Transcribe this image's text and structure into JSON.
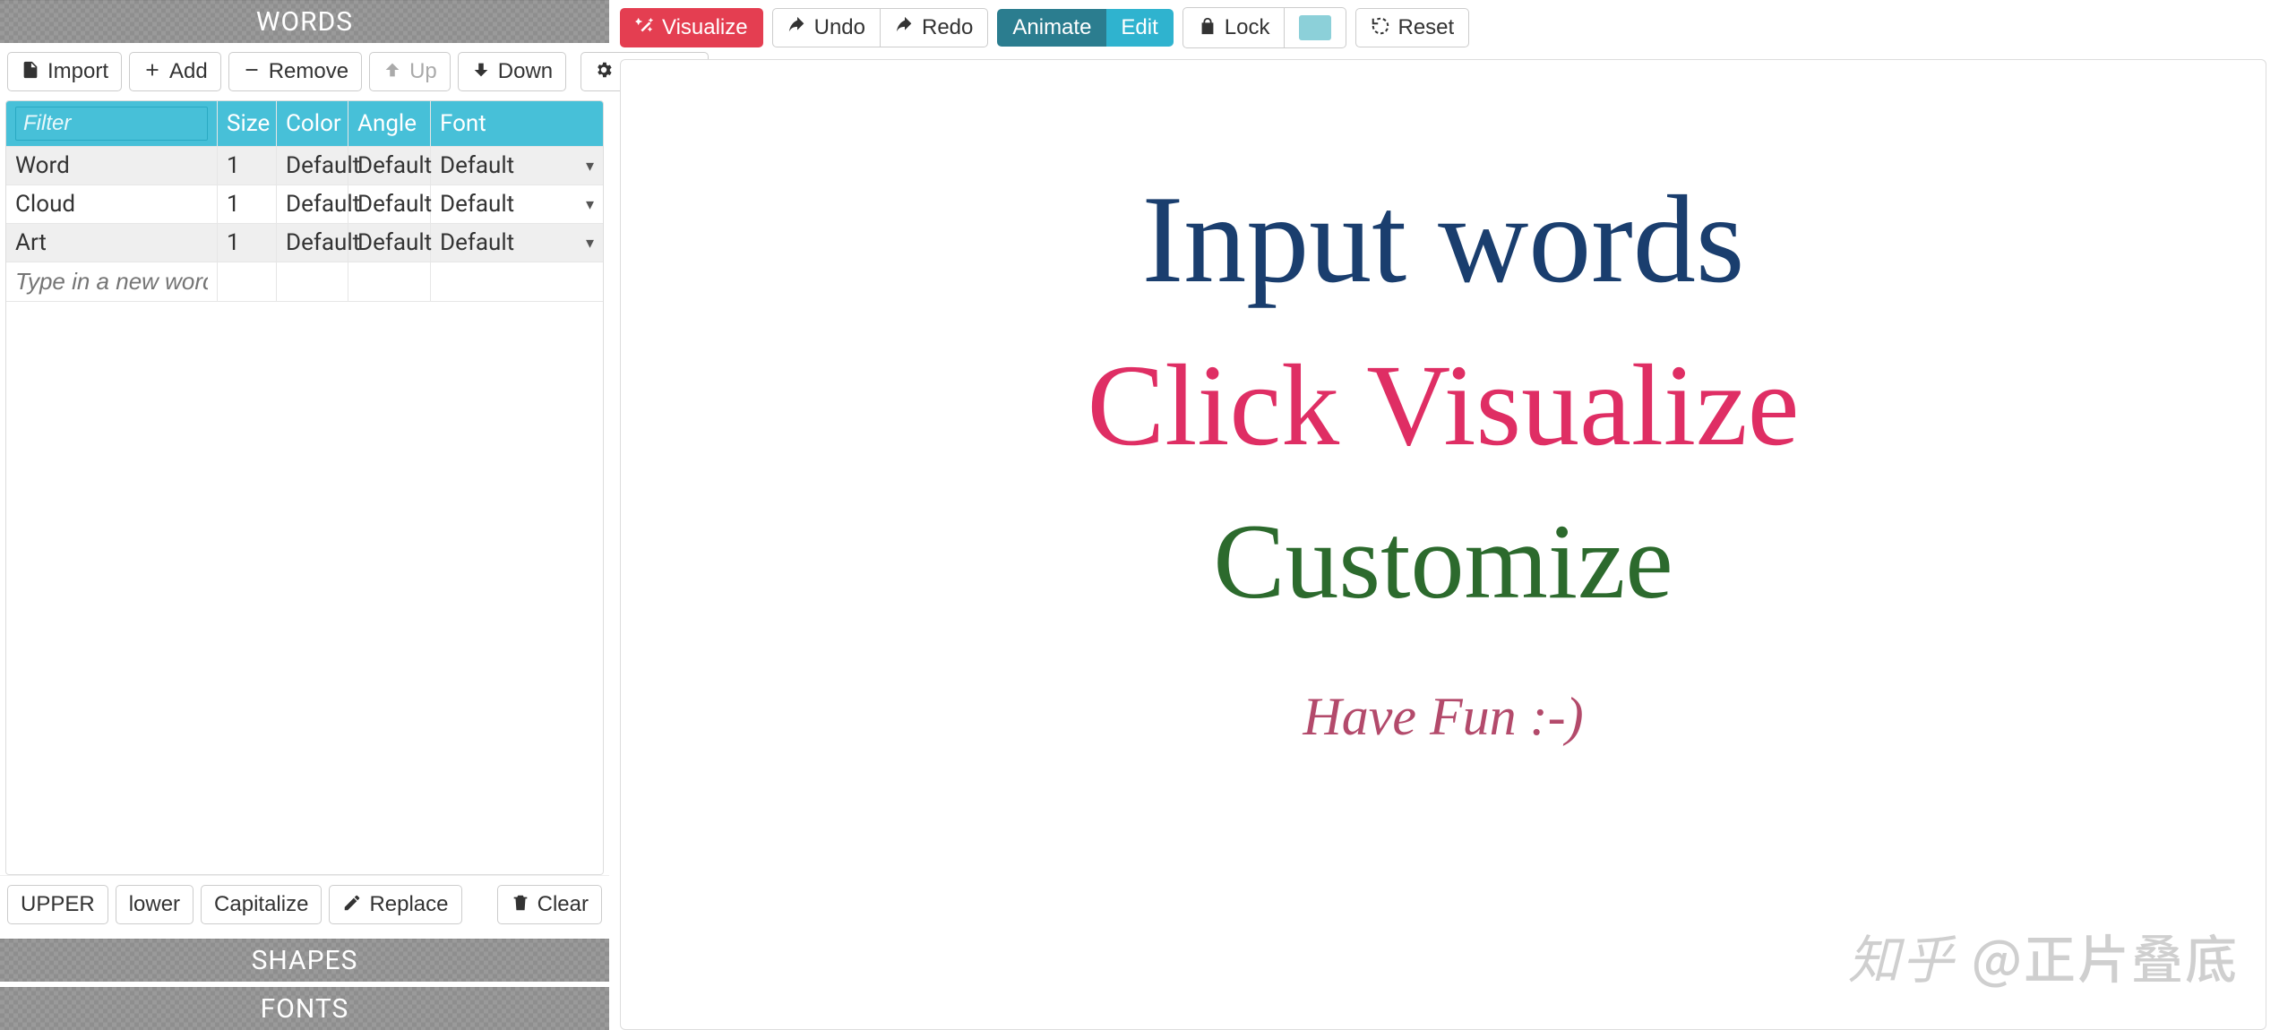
{
  "left": {
    "sections": {
      "words": "WORDS",
      "shapes": "SHAPES",
      "fonts": "FONTS"
    },
    "toolbar": {
      "import": "Import",
      "add": "Add",
      "remove": "Remove",
      "up": "Up",
      "down": "Down",
      "options": "Options"
    },
    "columns": {
      "filter_placeholder": "Filter",
      "size": "Size",
      "color": "Color",
      "angle": "Angle",
      "font": "Font"
    },
    "rows": [
      {
        "word": "Word",
        "size": "1",
        "color": "Default",
        "angle": "Default",
        "font": "Default"
      },
      {
        "word": "Cloud",
        "size": "1",
        "color": "Default",
        "angle": "Default",
        "font": "Default"
      },
      {
        "word": "Art",
        "size": "1",
        "color": "Default",
        "angle": "Default",
        "font": "Default"
      }
    ],
    "new_word_placeholder": "Type in a new word",
    "bottom": {
      "upper": "UPPER",
      "lower": "lower",
      "capitalize": "Capitalize",
      "replace": "Replace",
      "clear": "Clear"
    }
  },
  "right": {
    "toolbar": {
      "visualize": "Visualize",
      "undo": "Undo",
      "redo": "Redo",
      "animate": "Animate",
      "edit": "Edit",
      "lock": "Lock",
      "reset": "Reset"
    },
    "canvas": {
      "line1": "Input words",
      "line2": "Click Visualize",
      "line3": "Customize",
      "line4": "Have Fun :-)"
    },
    "watermark": {
      "logo": "知乎",
      "text": "@正片叠底"
    }
  }
}
